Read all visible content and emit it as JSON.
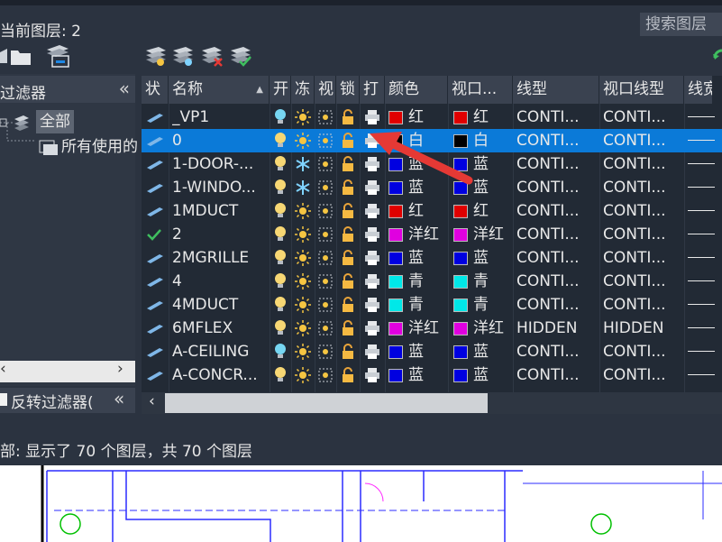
{
  "title": "当前图层: 2",
  "search": {
    "placeholder": "搜索图层"
  },
  "filter_panel": {
    "title": "过滤器",
    "collapse_glyph": "«",
    "tree": [
      {
        "label": "全部"
      },
      {
        "label": "所有使用的"
      }
    ],
    "invert_label": "反转过滤器(",
    "invert_glyph": "«"
  },
  "toolbar": {
    "left_icons": [
      "new-filter-icon",
      "folder-icon",
      "layer-states-icon"
    ],
    "right_icons": [
      "new-layer-icon",
      "new-layer-frozen-icon",
      "delete-layer-icon",
      "set-current-icon"
    ],
    "refresh_icon": "refresh-icon"
  },
  "table": {
    "columns": [
      "状",
      "名称",
      "开",
      "冻",
      "视",
      "锁",
      "打",
      "颜色",
      "视口...",
      "线型",
      "视口线型",
      "线宽"
    ],
    "rows": [
      {
        "status": "layer",
        "name": "_VP1",
        "bulb": "cyan",
        "freeze": "sun",
        "color_name": "红",
        "color_hex": "#e00000",
        "vp_color_name": "红",
        "vp_color_hex": "#e00000",
        "linetype": "CONTI...",
        "vp_linetype": "CONTI..."
      },
      {
        "status": "layer",
        "name": "0",
        "bulb": "yellow",
        "freeze": "sun",
        "color_name": "白",
        "color_hex": "#000000",
        "vp_color_name": "白",
        "vp_color_hex": "#000000",
        "linetype": "CONTI...",
        "vp_linetype": "CONTI...",
        "selected": true
      },
      {
        "status": "layer",
        "name": "1-DOOR-...",
        "bulb": "yellow",
        "freeze": "snow",
        "color_name": "蓝",
        "color_hex": "#0000e0",
        "vp_color_name": "蓝",
        "vp_color_hex": "#0000e0",
        "linetype": "CONTI...",
        "vp_linetype": "CONTI..."
      },
      {
        "status": "layer",
        "name": "1-WINDO...",
        "bulb": "yellow",
        "freeze": "snow",
        "color_name": "蓝",
        "color_hex": "#0000e0",
        "vp_color_name": "蓝",
        "vp_color_hex": "#0000e0",
        "linetype": "CONTI...",
        "vp_linetype": "CONTI..."
      },
      {
        "status": "layer",
        "name": "1MDUCT",
        "bulb": "yellow",
        "freeze": "sun",
        "color_name": "红",
        "color_hex": "#e00000",
        "vp_color_name": "红",
        "vp_color_hex": "#e00000",
        "linetype": "CONTI...",
        "vp_linetype": "CONTI..."
      },
      {
        "status": "current",
        "name": "2",
        "bulb": "yellow",
        "freeze": "sun",
        "color_name": "洋红",
        "color_hex": "#e000e0",
        "vp_color_name": "洋红",
        "vp_color_hex": "#e000e0",
        "linetype": "CONTI...",
        "vp_linetype": "CONTI..."
      },
      {
        "status": "layer",
        "name": "2MGRILLE",
        "bulb": "yellow",
        "freeze": "sun",
        "color_name": "蓝",
        "color_hex": "#0000e0",
        "vp_color_name": "蓝",
        "vp_color_hex": "#0000e0",
        "linetype": "CONTI...",
        "vp_linetype": "CONTI..."
      },
      {
        "status": "layer",
        "name": "4",
        "bulb": "yellow",
        "freeze": "sun",
        "color_name": "青",
        "color_hex": "#00e8e8",
        "vp_color_name": "青",
        "vp_color_hex": "#00e8e8",
        "linetype": "CONTI...",
        "vp_linetype": "CONTI..."
      },
      {
        "status": "layer",
        "name": "4MDUCT",
        "bulb": "yellow",
        "freeze": "sun",
        "color_name": "青",
        "color_hex": "#00e8e8",
        "vp_color_name": "青",
        "vp_color_hex": "#00e8e8",
        "linetype": "CONTI...",
        "vp_linetype": "CONTI..."
      },
      {
        "status": "layer",
        "name": "6MFLEX",
        "bulb": "yellow",
        "freeze": "sun",
        "color_name": "洋红",
        "color_hex": "#e000e0",
        "vp_color_name": "洋红",
        "vp_color_hex": "#e000e0",
        "linetype": "HIDDEN",
        "vp_linetype": "HIDDEN"
      },
      {
        "status": "layer",
        "name": "A-CEILING",
        "bulb": "cyan",
        "freeze": "sun",
        "color_name": "蓝",
        "color_hex": "#0000e0",
        "vp_color_name": "蓝",
        "vp_color_hex": "#0000e0",
        "linetype": "CONTI...",
        "vp_linetype": "CONTI..."
      },
      {
        "status": "layer",
        "name": "A-CONCR...",
        "bulb": "yellow",
        "freeze": "sun",
        "color_name": "蓝",
        "color_hex": "#0000e0",
        "vp_color_name": "蓝",
        "vp_color_hex": "#0000e0",
        "linetype": "CONTI...",
        "vp_linetype": "CONTI..."
      }
    ]
  },
  "status_bar": {
    "text": "部: 显示了 70 个图层，共 70 个图层"
  },
  "colors": {
    "panel_bg": "#2b3340",
    "header_bg": "#3a4250",
    "selected_row": "#0b7ad8",
    "arrow": "#e53935"
  }
}
